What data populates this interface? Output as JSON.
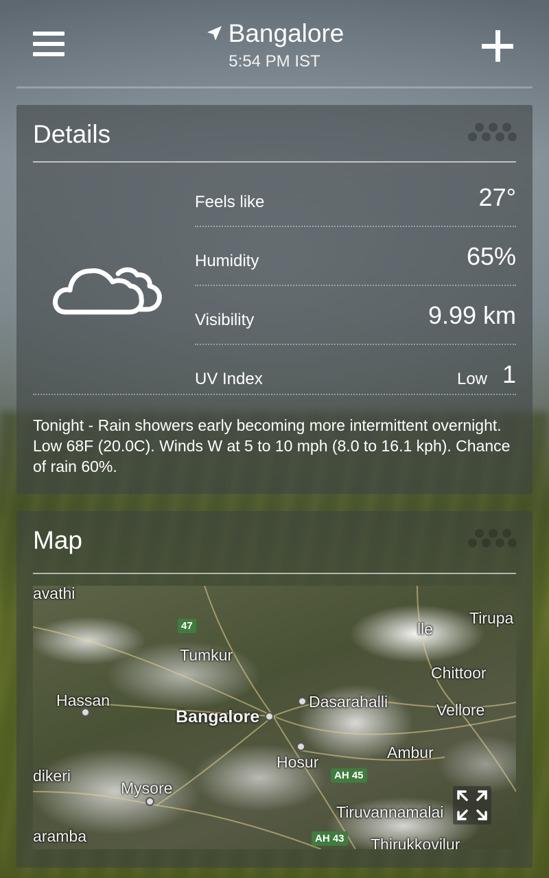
{
  "header": {
    "location": "Bangalore",
    "time": "5:54 PM IST",
    "menu_icon": "hamburger-menu-icon",
    "location_icon": "location-arrow-icon",
    "add_icon": "plus-icon"
  },
  "details": {
    "title": "Details",
    "condition_icon": "cloud-icon",
    "rows": [
      {
        "label": "Feels like",
        "value": "27°"
      },
      {
        "label": "Humidity",
        "value": "65%"
      },
      {
        "label": "Visibility",
        "value": "9.99 km"
      },
      {
        "label": "UV Index",
        "level": "Low",
        "value": "1"
      }
    ],
    "description": "Tonight - Rain showers early becoming more intermittent overnight. Low 68F (20.0C). Winds W at 5 to 10 mph (8.0 to 16.1 kph). Chance of rain 60%."
  },
  "map": {
    "title": "Map",
    "places": [
      "avathi",
      "Tumkur",
      "Tirupa",
      "Chittoor",
      "Hassan",
      "Bangalore",
      "Dasarahalli",
      "Vellore",
      "Hosur",
      "Ambur",
      "dikeri",
      "Mysore",
      "Tiruvannamalai",
      "aramba",
      "Thirukkovilur",
      "lle"
    ],
    "road_shields": [
      "47",
      "AH 45",
      "AH 43"
    ],
    "expand_icon": "expand-fullscreen-icon"
  },
  "colors": {
    "text": "#ffffff",
    "card_bg": "rgba(60,65,68,0.55)",
    "highway_shield": "#3f7d3e"
  }
}
